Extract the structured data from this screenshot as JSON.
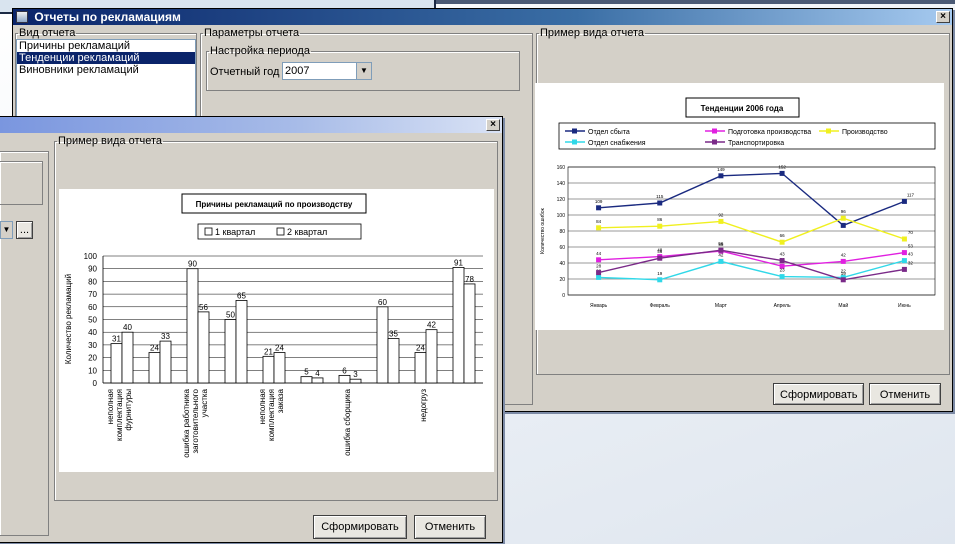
{
  "main_window": {
    "title": "Отчеты по рекламациям",
    "report_type_legend": "Вид отчета",
    "report_types": [
      {
        "label": "Причины рекламаций",
        "selected": false
      },
      {
        "label": "Тенденции рекламаций",
        "selected": true
      },
      {
        "label": "Виновники рекламаций",
        "selected": false
      }
    ],
    "params_legend": "Параметры отчета",
    "period_legend": "Настройка периода",
    "year_label": "Отчетный год",
    "year_value": "2007",
    "preview_legend": "Пример вида отчета",
    "generate_button": "Сформировать",
    "cancel_button": "Отменить"
  },
  "second_window": {
    "preview_legend": "Пример вида отчета",
    "ellipsis_button": "...",
    "generate_button": "Сформировать",
    "cancel_button": "Отменить"
  },
  "colors": {
    "title_active": "#0a246a",
    "selected": "#0a246a",
    "dialog": "#d4d0c8"
  },
  "chart_data": [
    {
      "type": "line",
      "title": "Тенденции 2006 года",
      "ylabel": "Количество ошибок",
      "categories": [
        "Январь",
        "Февраль",
        "Март",
        "Апрель",
        "Май",
        "Июнь"
      ],
      "ylim": [
        0,
        160
      ],
      "yticks": [
        "0",
        "20",
        "40",
        "60",
        "80",
        "100",
        "120",
        "140",
        "160"
      ],
      "series": [
        {
          "name": "Отдел сбыта",
          "color": "#1a2a80",
          "values": [
            109,
            115,
            149,
            152,
            87,
            117
          ],
          "labels": [
            "109",
            "115",
            "149",
            "152",
            "87",
            "117"
          ]
        },
        {
          "name": "Подготовка производства",
          "color": "#e020e0",
          "values": [
            44,
            48,
            55,
            36,
            42,
            53
          ],
          "labels": [
            "44",
            "48",
            "55",
            "36",
            "42",
            "53"
          ]
        },
        {
          "name": "Производство",
          "color": "#f0f020",
          "values": [
            84,
            86,
            92,
            66,
            96,
            70
          ],
          "labels": [
            "84",
            "86",
            "92",
            "66",
            "96",
            "70"
          ]
        },
        {
          "name": "Отдел снабжения",
          "color": "#30d8e8",
          "values": [
            22,
            19,
            42,
            23,
            22,
            43
          ],
          "labels": [
            "22",
            "19",
            "42",
            "23",
            "22",
            "43"
          ]
        },
        {
          "name": "Транспортировка",
          "color": "#7a2a88",
          "values": [
            28,
            46,
            56,
            43,
            19,
            32
          ],
          "labels": [
            "28",
            "46",
            "56",
            "43",
            "19",
            "32"
          ]
        }
      ],
      "legend": "top"
    },
    {
      "type": "bar",
      "title": "Причины рекламаций по производству",
      "ylabel": "Количество рекламаций",
      "ylim": [
        0,
        100
      ],
      "yticks": [
        "0",
        "10",
        "20",
        "30",
        "40",
        "50",
        "60",
        "70",
        "80",
        "90",
        "100"
      ],
      "categories": [
        "неполная комплектация фурнитуры",
        "",
        "ошибка работника заготовительного участка",
        "",
        "неполная комплектация заказа",
        "",
        "ошибка сборщика",
        "",
        "недогруз",
        ""
      ],
      "category_lines": [
        [
          "неполная",
          "комплектация",
          "фурнитуры"
        ],
        [],
        [
          "ошибка работника",
          "заготовительного",
          "участка"
        ],
        [],
        [
          "неполная",
          "комплектация",
          "заказа"
        ],
        [],
        [
          "ошибка сборщика"
        ],
        [],
        [
          "недогруз"
        ],
        []
      ],
      "series": [
        {
          "name": "1 квартал",
          "values": [
            31,
            24,
            90,
            50,
            21,
            5,
            6,
            60,
            24,
            91
          ]
        },
        {
          "name": "2 квартал",
          "values": [
            40,
            33,
            56,
            65,
            24,
            4,
            3,
            35,
            42,
            78
          ]
        }
      ],
      "legend": "top"
    }
  ]
}
